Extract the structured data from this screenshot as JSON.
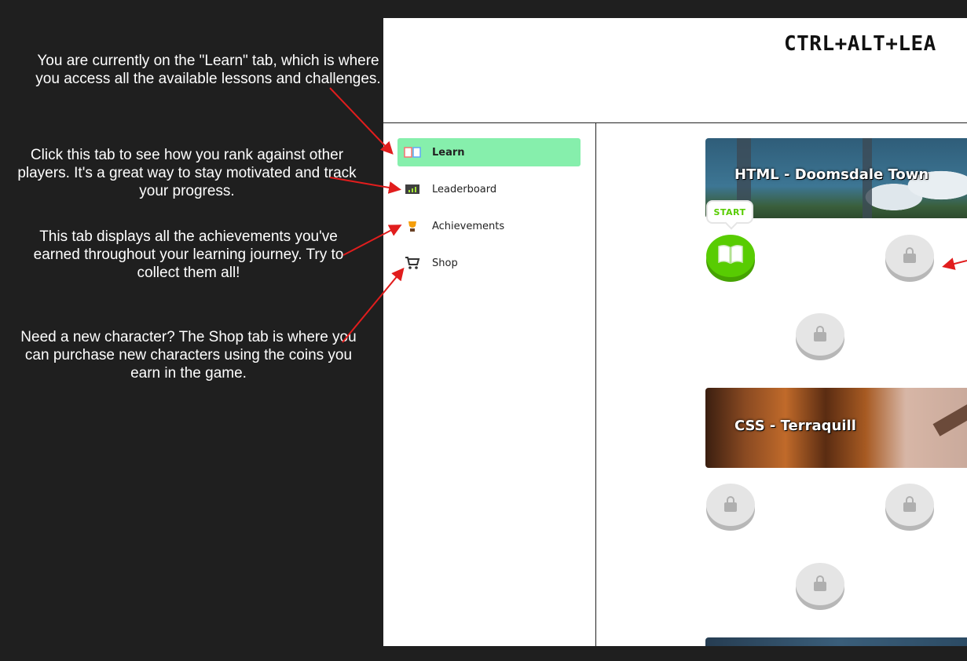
{
  "annotations": {
    "learn": "You are currently on the \"Learn\" tab, which is where you access all the available lessons and challenges.",
    "leaderboard": "Click this tab to see how you rank against other players.  It's a great way to stay motivated and track your progress.",
    "achievements": "This tab displays all the achievements you've earned throughout your learning journey.  Try to collect them all!",
    "shop": "Need a new character? The Shop tab is where you can purchase new characters using the coins you earn in the game."
  },
  "app": {
    "title": "CTRL+ALT+LEA"
  },
  "sidebar": {
    "items": [
      {
        "label": "Learn",
        "icon": "book-icon",
        "active": true
      },
      {
        "label": "Leaderboard",
        "icon": "chart-icon",
        "active": false
      },
      {
        "label": "Achievements",
        "icon": "trophy-icon",
        "active": false
      },
      {
        "label": "Shop",
        "icon": "cart-icon",
        "active": false
      }
    ]
  },
  "units": [
    {
      "title": "HTML - Doomsdale Town",
      "start_label": "START"
    },
    {
      "title": "CSS - Terraquill"
    }
  ],
  "colors": {
    "background": "#1f1f1f",
    "active_tab": "#86efac",
    "start_node": "#58cc02",
    "locked_node": "#e5e5e5",
    "arrow": "#e11d1d"
  }
}
